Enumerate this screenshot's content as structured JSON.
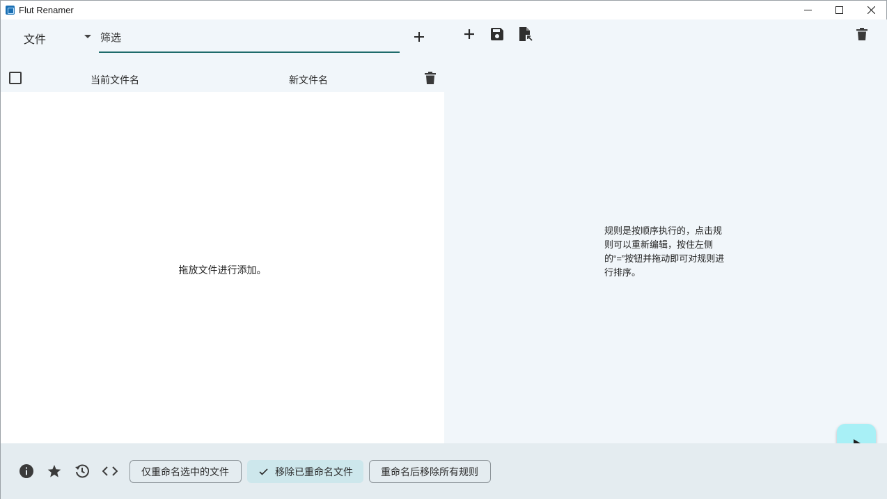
{
  "window": {
    "title": "Flut Renamer",
    "controls": [
      "minimize",
      "maximize",
      "close"
    ]
  },
  "file_panel": {
    "type_select": {
      "value": "文件"
    },
    "filter": {
      "placeholder": "筛选",
      "value": ""
    },
    "add_icon": "plus-icon",
    "columns": {
      "current": "当前文件名",
      "new": "新文件名"
    },
    "select_all_checked": false,
    "empty_hint": "拖放文件进行添加。"
  },
  "rules_panel": {
    "toolbar_icons": [
      "plus-icon",
      "save-icon",
      "file-export-icon",
      "delete-icon"
    ],
    "empty_hint": "规则是按顺序执行的，点击规则可以重新编辑，按住左侧的“=”按钮并拖动即可对规则进行排序。"
  },
  "bottom_bar": {
    "icons": [
      "info-icon",
      "star-icon",
      "history-icon",
      "code-icon"
    ],
    "chips": [
      {
        "label": "仅重命名选中的文件",
        "selected": false
      },
      {
        "label": "移除已重命名文件",
        "selected": true
      },
      {
        "label": "重命名后移除所有规则",
        "selected": false
      }
    ]
  },
  "colors": {
    "panel_background": "#f1f6fa",
    "bottom_background": "#e4ecf0",
    "accent_underline": "#1e6b6b",
    "fab_background": "#a8f0f6",
    "chip_selected": "#cde7ec"
  }
}
